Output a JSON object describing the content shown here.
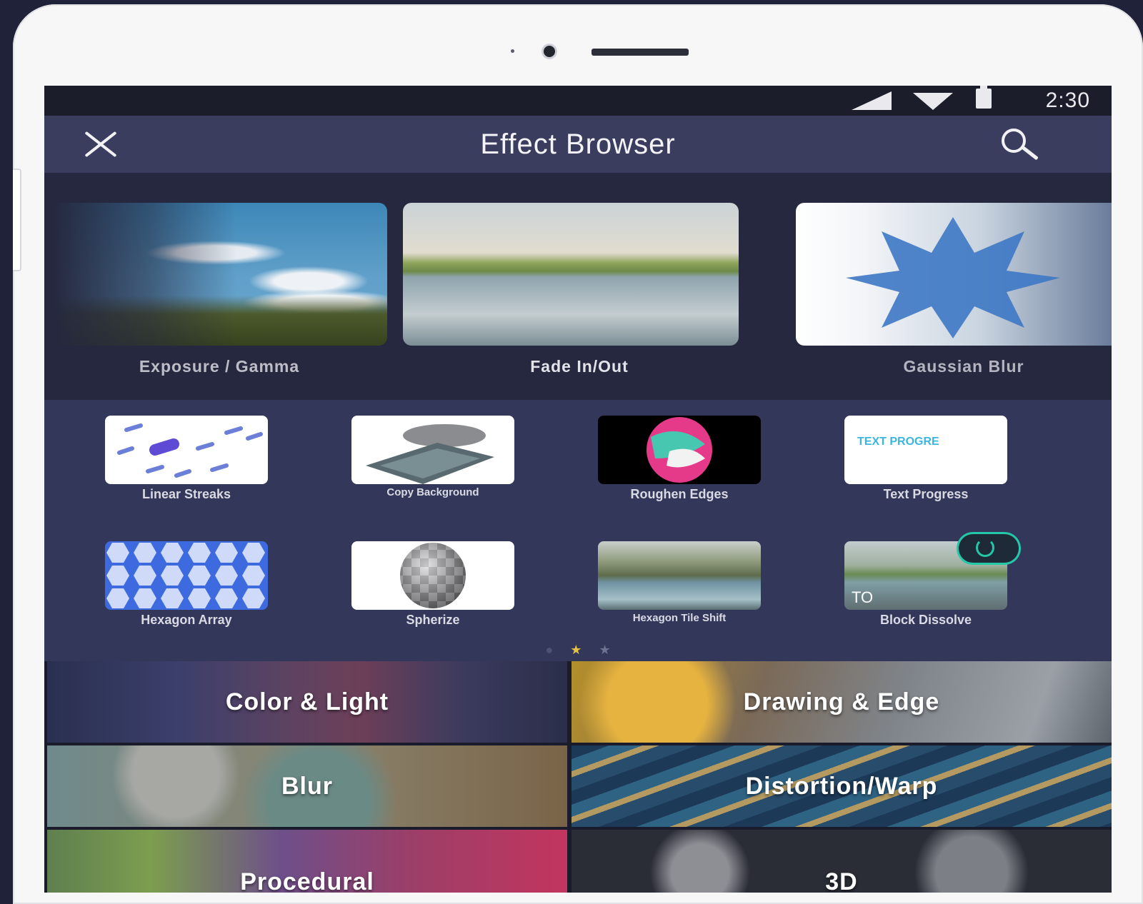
{
  "status_bar": {
    "time": "2:30"
  },
  "toolbar": {
    "title": "Effect Browser"
  },
  "featured": [
    {
      "label": "Exposure / Gamma"
    },
    {
      "label": "Fade In/Out"
    },
    {
      "label": "Gaussian Blur"
    }
  ],
  "effects_grid": [
    {
      "label": "Linear Streaks"
    },
    {
      "label": "Copy Background"
    },
    {
      "label": "Roughen Edges"
    },
    {
      "label": "Text Progress",
      "thumb_text": "TEXT PROGRE"
    },
    {
      "label": "Hexagon Array"
    },
    {
      "label": "Spherize"
    },
    {
      "label": "Hexagon Tile Shift"
    },
    {
      "label": "Block Dissolve",
      "thumb_text": "TO"
    }
  ],
  "pager": {
    "total": 3,
    "active_index": 1
  },
  "categories": [
    {
      "label": "Color & Light"
    },
    {
      "label": "Drawing & Edge"
    },
    {
      "label": "Blur"
    },
    {
      "label": "Distortion/Warp"
    },
    {
      "label": "Procedural"
    },
    {
      "label": "3D"
    }
  ],
  "colors": {
    "screen_bg": "#33375a",
    "toolbar_bg": "#3a3d5e",
    "accent_star": "#e6c23f",
    "badge": "#25c7a8"
  }
}
